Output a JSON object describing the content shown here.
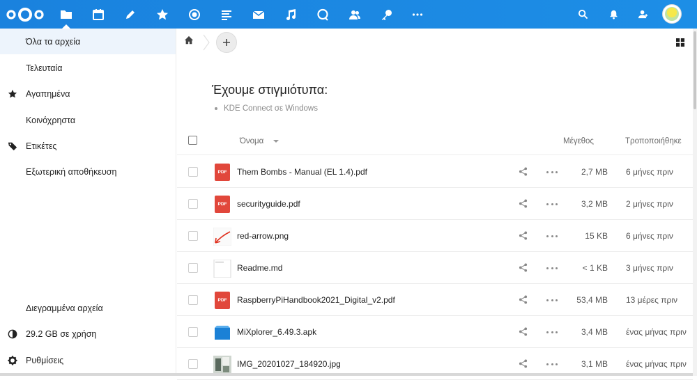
{
  "topbar": {
    "bg_color": "#1a82de",
    "apps": [
      {
        "name": "files",
        "icon": "folder-icon"
      },
      {
        "name": "calendar",
        "icon": "calendar-icon"
      },
      {
        "name": "notes",
        "icon": "pencil-icon"
      },
      {
        "name": "favorites",
        "icon": "star-icon"
      },
      {
        "name": "activity",
        "icon": "activity-icon"
      },
      {
        "name": "text",
        "icon": "text-icon"
      },
      {
        "name": "mail",
        "icon": "mail-icon"
      },
      {
        "name": "music",
        "icon": "music-icon"
      },
      {
        "name": "talk",
        "icon": "talk-icon"
      },
      {
        "name": "contacts",
        "icon": "contacts-icon"
      },
      {
        "name": "settings",
        "icon": "key-icon"
      },
      {
        "name": "more",
        "icon": "more-icon"
      }
    ],
    "right": [
      "search-icon",
      "bell-icon",
      "contacts-menu-icon"
    ]
  },
  "sidebar": {
    "items": [
      {
        "label": "Όλα τα αρχεία",
        "icon": ""
      },
      {
        "label": "Τελευταία",
        "icon": ""
      },
      {
        "label": "Αγαπημένα",
        "icon": "star-icon"
      },
      {
        "label": "Κοινόχρηστα",
        "icon": ""
      },
      {
        "label": "Ετικέτες",
        "icon": "tag-icon"
      },
      {
        "label": "Εξωτερική αποθήκευση",
        "icon": ""
      }
    ],
    "bottom": {
      "deleted": "Διεγραμμένα αρχεία",
      "quota": "29.2 GB σε χρήση",
      "settings": "Ρυθμίσεις"
    }
  },
  "readme": {
    "title": "Έχουμε στιγμιότυπα:",
    "item": "KDE Connect σε Windows"
  },
  "table": {
    "col_name": "Όνομα",
    "col_size": "Μέγεθος",
    "col_modified": "Τροποποιήθηκε",
    "rows": [
      {
        "name": "Them Bombs - Manual (EL 1.4).pdf",
        "size": "2,7 MB",
        "modified": "6 μήνες πριν",
        "type": "pdf"
      },
      {
        "name": "securityguide.pdf",
        "size": "3,2 MB",
        "modified": "2 μήνες πριν",
        "type": "pdf"
      },
      {
        "name": "red-arrow.png",
        "size": "15 KB",
        "modified": "6 μήνες πριν",
        "type": "image-arrow"
      },
      {
        "name": "Readme.md",
        "size": "< 1 KB",
        "modified": "3 μήνες πριν",
        "type": "text"
      },
      {
        "name": "RaspberryPiHandbook2021_Digital_v2.pdf",
        "size": "53,4 MB",
        "modified": "13 μέρες πριν",
        "type": "pdf"
      },
      {
        "name": "MiXplorer_6.49.3.apk",
        "size": "3,4 MB",
        "modified": "ένας μήνας πριν",
        "type": "package"
      },
      {
        "name": "IMG_20201027_184920.jpg",
        "size": "3,1 MB",
        "modified": "ένας μήνας πριν",
        "type": "photo"
      }
    ],
    "pdf_badge": "PDF"
  }
}
